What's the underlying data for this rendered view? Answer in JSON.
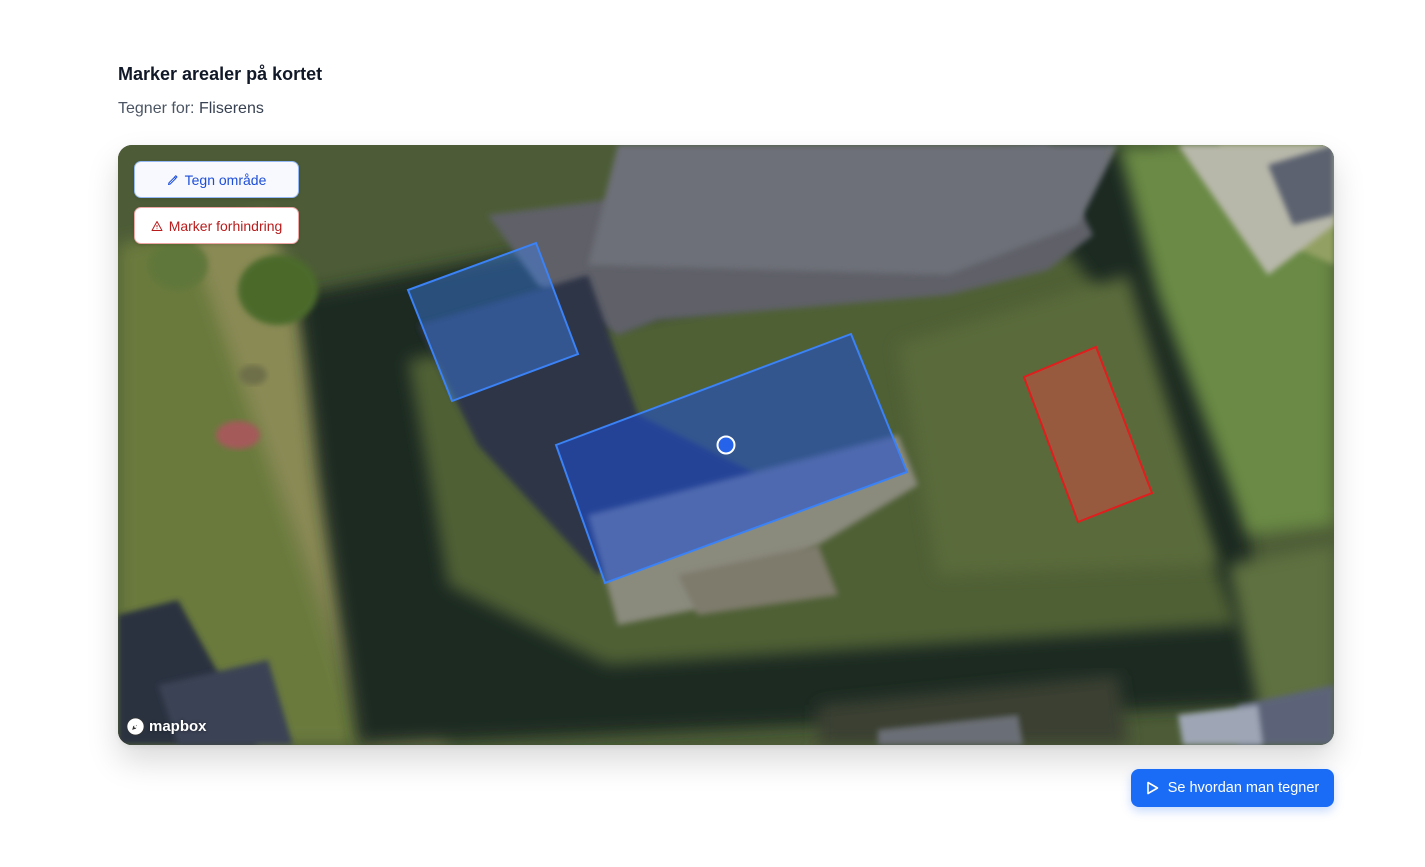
{
  "header": {
    "title": "Marker arealer på kortet",
    "subtitle_label": "Tegner for:",
    "subtitle_value": "Fliserens"
  },
  "map": {
    "tools": {
      "draw_label": "Tegn område",
      "draw_icon": "pencil-icon",
      "obstacle_label": "Marker forhindring",
      "obstacle_icon": "warning-triangle-icon"
    },
    "attribution": "mapbox",
    "areas": [
      {
        "kind": "area",
        "color": "#3b82f6"
      },
      {
        "kind": "area",
        "color": "#3b82f6"
      },
      {
        "kind": "obstacle",
        "color": "#e11d1d"
      }
    ]
  },
  "footer": {
    "cta_label": "Se hvordan man tegner",
    "cta_icon": "play-icon",
    "cta_color": "#1a6bf5"
  }
}
